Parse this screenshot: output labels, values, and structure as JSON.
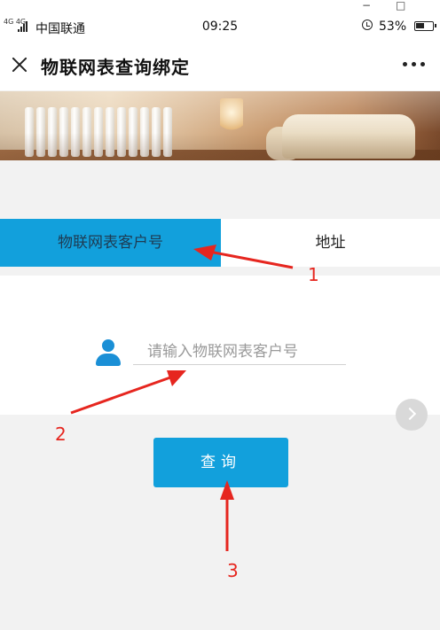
{
  "status_bar": {
    "network": "4G 4G",
    "carrier": "中国联通",
    "time": "09:25",
    "battery": "53%"
  },
  "window_controls": {
    "minimize": "−",
    "maximize": "□"
  },
  "header": {
    "title": "物联网表查询绑定",
    "close_icon": "close-icon",
    "more_icon": "more-icon"
  },
  "tabs": [
    {
      "label": "物联网表客户号",
      "active": true
    },
    {
      "label": "地址",
      "active": false
    }
  ],
  "form": {
    "input_placeholder": "请输入物联网表客户号",
    "input_value": "",
    "user_icon": "user-icon",
    "submit_label": "查询"
  },
  "annotations": [
    "1",
    "2",
    "3"
  ],
  "colors": {
    "accent": "#12a0dc",
    "icon_blue": "#1a8fd6",
    "annotation_red": "#e6261f",
    "background": "#f2f2f2"
  }
}
